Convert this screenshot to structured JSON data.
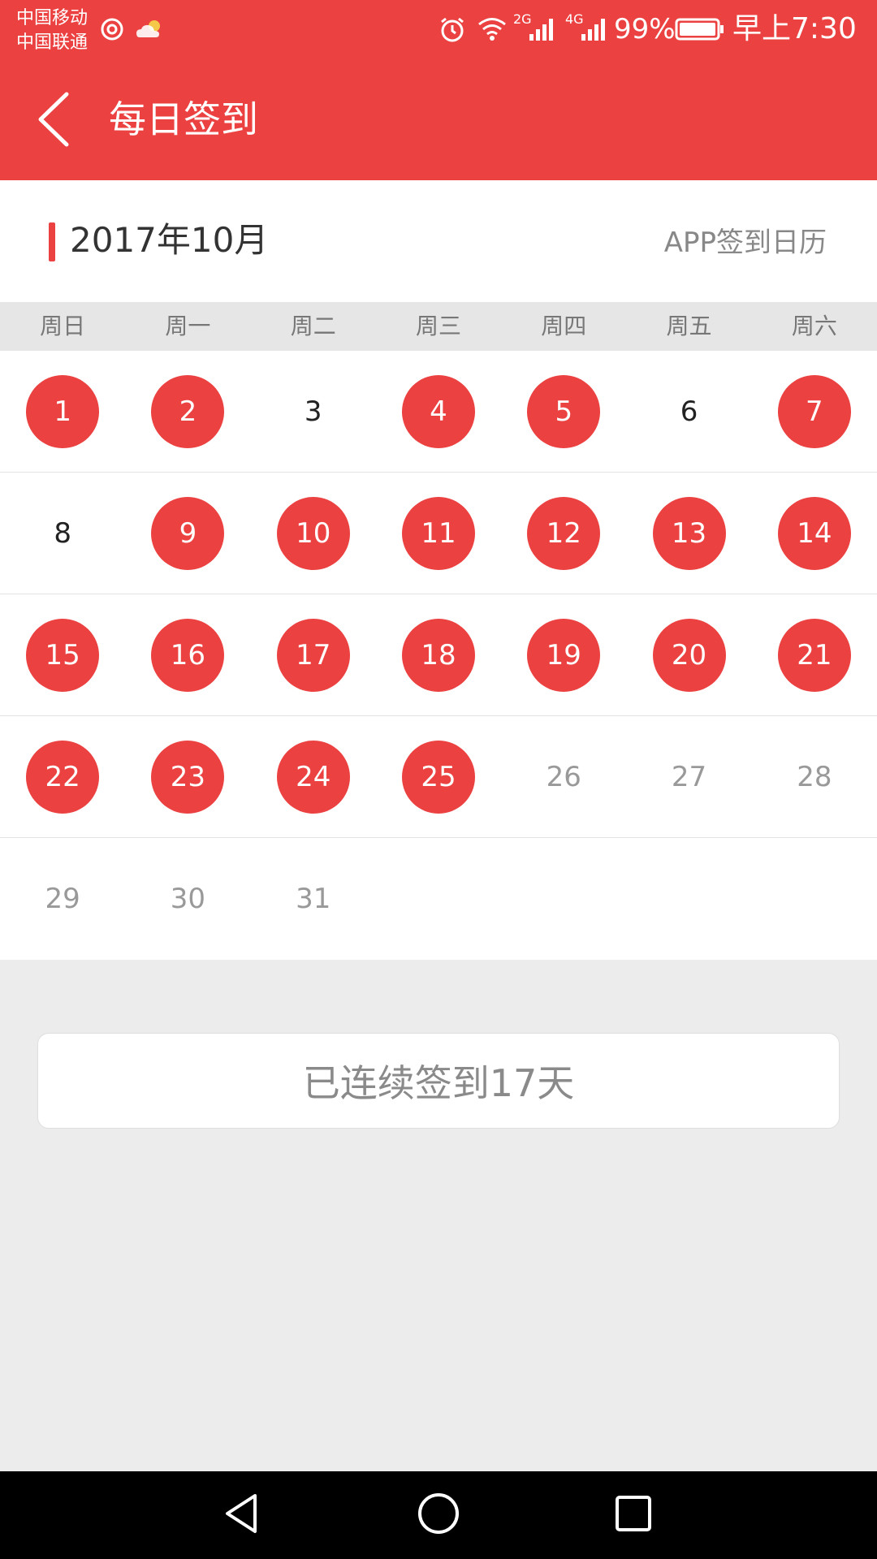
{
  "status_bar": {
    "carrier_1": "中国移动",
    "carrier_2": "中国联通",
    "network_2g": "2G",
    "network_4g": "4G",
    "battery": "99%",
    "time": "早上7:30"
  },
  "app_bar": {
    "title": "每日签到",
    "back_icon": "chevron-left-icon"
  },
  "calendar": {
    "month_title": "2017年10月",
    "link_label": "APP签到日历",
    "weekdays": [
      "周日",
      "周一",
      "周二",
      "周三",
      "周四",
      "周五",
      "周六"
    ],
    "weeks": [
      [
        {
          "day": "1",
          "state": "checked"
        },
        {
          "day": "2",
          "state": "checked"
        },
        {
          "day": "3",
          "state": "missed"
        },
        {
          "day": "4",
          "state": "checked"
        },
        {
          "day": "5",
          "state": "checked"
        },
        {
          "day": "6",
          "state": "missed"
        },
        {
          "day": "7",
          "state": "checked"
        }
      ],
      [
        {
          "day": "8",
          "state": "missed"
        },
        {
          "day": "9",
          "state": "checked"
        },
        {
          "day": "10",
          "state": "checked"
        },
        {
          "day": "11",
          "state": "checked"
        },
        {
          "day": "12",
          "state": "checked"
        },
        {
          "day": "13",
          "state": "checked"
        },
        {
          "day": "14",
          "state": "checked"
        }
      ],
      [
        {
          "day": "15",
          "state": "checked"
        },
        {
          "day": "16",
          "state": "checked"
        },
        {
          "day": "17",
          "state": "checked"
        },
        {
          "day": "18",
          "state": "checked"
        },
        {
          "day": "19",
          "state": "checked"
        },
        {
          "day": "20",
          "state": "checked"
        },
        {
          "day": "21",
          "state": "checked"
        }
      ],
      [
        {
          "day": "22",
          "state": "checked"
        },
        {
          "day": "23",
          "state": "checked"
        },
        {
          "day": "24",
          "state": "checked"
        },
        {
          "day": "25",
          "state": "checked"
        },
        {
          "day": "26",
          "state": "future"
        },
        {
          "day": "27",
          "state": "future"
        },
        {
          "day": "28",
          "state": "future"
        }
      ],
      [
        {
          "day": "29",
          "state": "future"
        },
        {
          "day": "30",
          "state": "future"
        },
        {
          "day": "31",
          "state": "future"
        },
        {
          "day": "",
          "state": "empty"
        },
        {
          "day": "",
          "state": "empty"
        },
        {
          "day": "",
          "state": "empty"
        },
        {
          "day": "",
          "state": "empty"
        }
      ]
    ]
  },
  "summary": {
    "text": "已连续签到17天"
  },
  "colors": {
    "accent": "#ec4141",
    "background": "#ececec"
  }
}
